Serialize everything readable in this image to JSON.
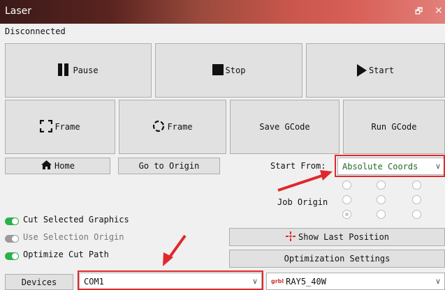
{
  "window": {
    "title": "Laser",
    "restore_glyph": "🗗",
    "close_glyph": "×"
  },
  "status": "Disconnected",
  "buttons": {
    "pause": "Pause",
    "stop": "Stop",
    "start": "Start",
    "frame_rect": "Frame",
    "frame_circle": "Frame",
    "save_gcode": "Save GCode",
    "run_gcode": "Run GCode",
    "home": "Home",
    "go_origin": "Go to Origin",
    "show_last_position": "Show Last Position",
    "optimization_settings": "Optimization Settings",
    "devices": "Devices"
  },
  "start_from": {
    "label": "Start From:",
    "value": "Absolute Coords"
  },
  "job_origin": {
    "label": "Job Origin",
    "selected_index": 6
  },
  "options": [
    {
      "label": "Cut Selected Graphics",
      "on": true
    },
    {
      "label": "Use Selection Origin",
      "on": false
    },
    {
      "label": "Optimize Cut Path",
      "on": true
    }
  ],
  "port": {
    "value": "COM1"
  },
  "device": {
    "prefix": "grbl",
    "value": "RAY5_40W"
  },
  "colors": {
    "highlight": "#e0282c",
    "toggle_on": "#29b24a",
    "toggle_off": "#9b9b9b",
    "device_prefix": "#cc3333"
  }
}
